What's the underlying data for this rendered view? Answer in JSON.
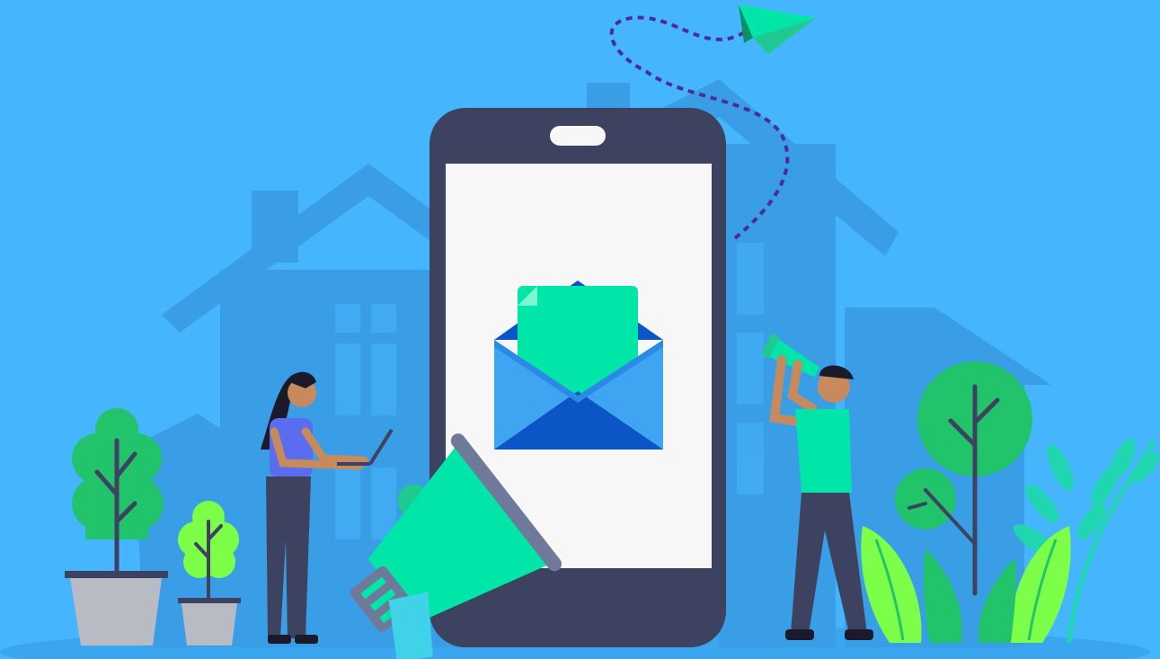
{
  "scene": {
    "description_label": "",
    "colors": {
      "sky": "#45b6fe",
      "house_shadow": "#3a9ee6",
      "house_dark": "#3593db",
      "phone_body": "#3c4260",
      "phone_screen": "#f7f7f8",
      "envelope_light": "#3fa5f2",
      "envelope_dark": "#0b55c7",
      "mint": "#00e6a8",
      "leaf_green": "#21c46a",
      "lime": "#7dff4a",
      "pot": "#b8bac4",
      "trail": "#4b2d9a",
      "skin": "#c78a5c",
      "hair": "#1b1a2a",
      "shirt_woman": "#5a6cf0",
      "pants": "#3c4260"
    },
    "icons": {
      "envelope": "envelope-icon",
      "paper_plane": "paper-plane-icon",
      "megaphone": "megaphone-icon",
      "telescope": "telescope-icon"
    }
  }
}
